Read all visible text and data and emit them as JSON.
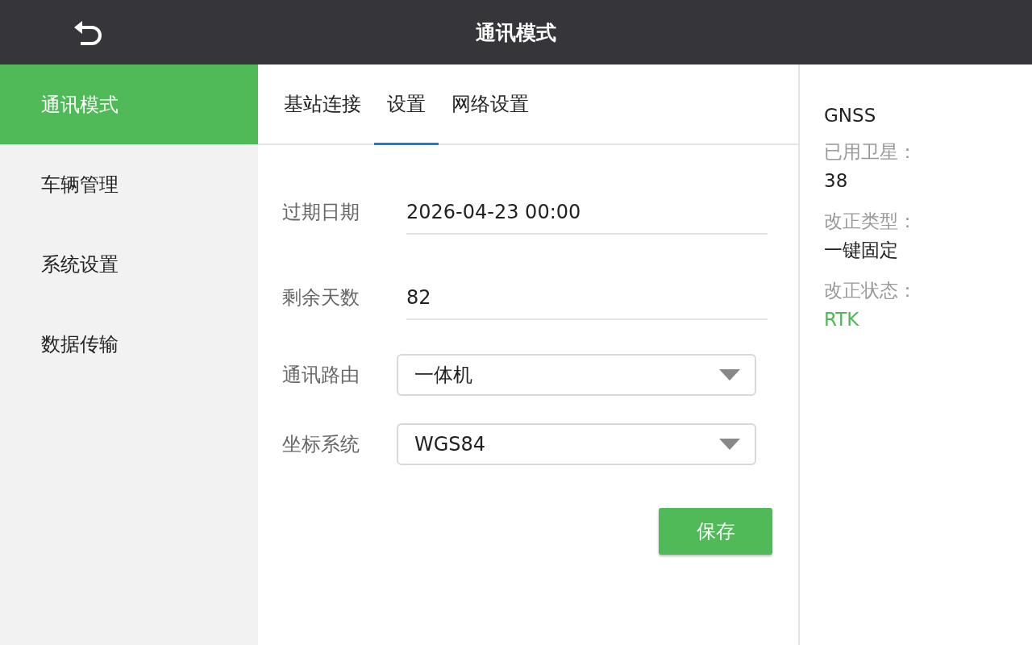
{
  "header": {
    "title": "通讯模式"
  },
  "sidebar": {
    "items": [
      {
        "label": "通讯模式",
        "selected": true
      },
      {
        "label": "车辆管理",
        "selected": false
      },
      {
        "label": "系统设置",
        "selected": false
      },
      {
        "label": "数据传输",
        "selected": false
      }
    ]
  },
  "tabs": [
    {
      "label": "基站连接",
      "selected": false
    },
    {
      "label": "设置",
      "selected": true
    },
    {
      "label": "网络设置",
      "selected": false
    }
  ],
  "form": {
    "fields": [
      {
        "kind": "text",
        "label": "过期日期",
        "value": "2026-04-23 00:00"
      },
      {
        "kind": "text",
        "label": "剩余天数",
        "value": "82"
      },
      {
        "kind": "select",
        "label": "通讯路由",
        "value": "一体机"
      },
      {
        "kind": "select",
        "label": "坐标系统",
        "value": "WGS84"
      }
    ],
    "save_button": "保存"
  },
  "status_panel": {
    "title": "GNSS",
    "items": [
      {
        "label": "已用卫星：",
        "value": "38",
        "color": "#222222"
      },
      {
        "label": "改正类型：",
        "value": "一键固定",
        "color": "#222222"
      },
      {
        "label": "改正状态：",
        "value": "RTK",
        "color": "#4cb856"
      }
    ]
  }
}
